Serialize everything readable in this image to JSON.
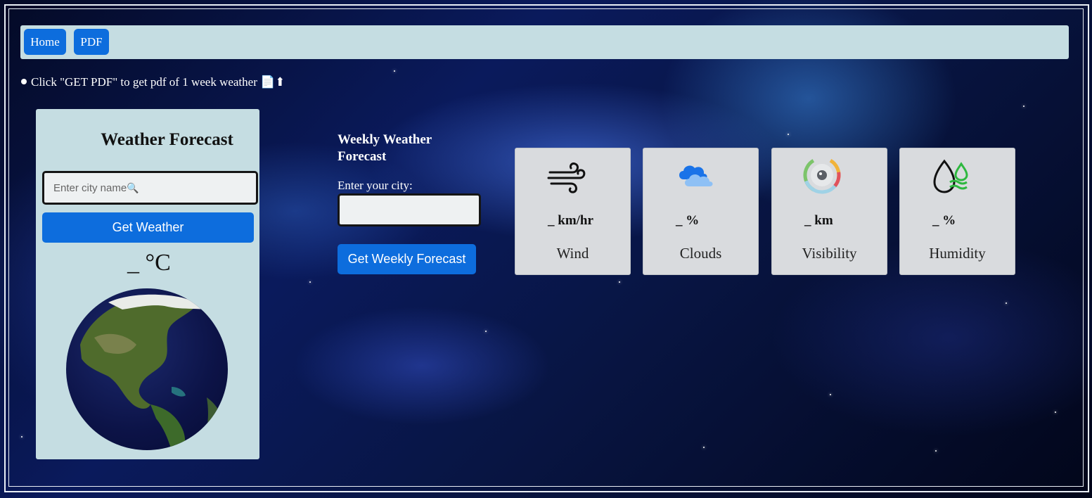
{
  "nav": {
    "home_label": "Home",
    "pdf_label": "PDF"
  },
  "notice": {
    "text": "Click \"GET PDF\" to get pdf of 1 week weather 📄⬆"
  },
  "weather_card": {
    "title": "Weather Forecast",
    "city_placeholder": "Enter city name",
    "get_weather_label": "Get Weather",
    "temp_value": "_",
    "temp_unit": "°C",
    "globe_icon": "earth-globe-image"
  },
  "weekly": {
    "title": "Weekly Weather Forecast",
    "city_label": "Enter your city:",
    "city_value": "",
    "button_label": "Get Weekly Forecast"
  },
  "metrics": [
    {
      "icon": "wind-icon",
      "value": "_ km/hr",
      "label": "Wind"
    },
    {
      "icon": "cloud-icon",
      "value": "_ %",
      "label": "Clouds"
    },
    {
      "icon": "visibility-eye-icon",
      "value": "_ km",
      "label": "Visibility"
    },
    {
      "icon": "humidity-drop-icon",
      "value": "_ %",
      "label": "Humidity"
    }
  ],
  "colors": {
    "primary_button": "#0d6ddd",
    "panel_background": "#c5dde2",
    "metric_card_background": "#d9dbde",
    "humidity_accent": "#2eb83f"
  }
}
